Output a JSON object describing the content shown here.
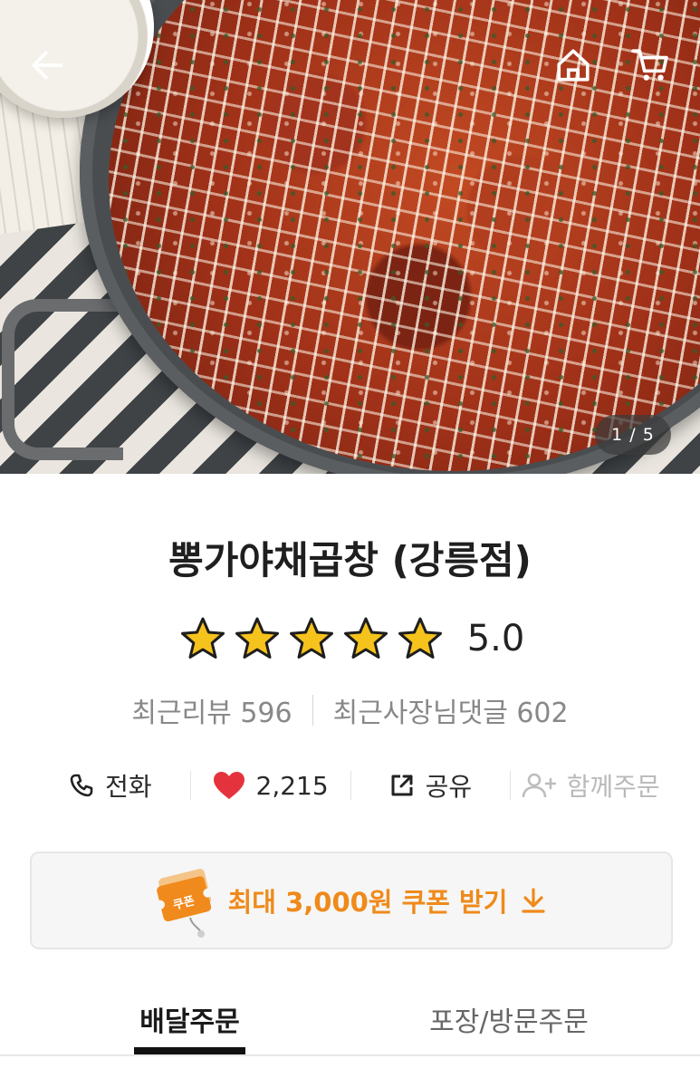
{
  "header": {
    "back_icon": "arrow-left-icon",
    "home_icon": "home-icon",
    "cart_icon": "cart-icon",
    "image_counter": "1 / 5"
  },
  "store": {
    "name": "뽕가야채곱창 (강릉점)",
    "rating": "5.0",
    "stars": 5,
    "recent_reviews": "최근리뷰 596",
    "owner_replies": "최근사장님댓글 602"
  },
  "actions": {
    "call_label": "전화",
    "like_count": "2,215",
    "share_label": "공유",
    "group_order_label": "함께주문"
  },
  "coupon": {
    "badge_text": "쿠폰",
    "label": "최대 3,000원 쿠폰 받기",
    "accent_color": "#ef8a1a"
  },
  "tabs": [
    {
      "label": "배달주문",
      "active": true
    },
    {
      "label": "포장/방문주문",
      "active": false
    }
  ],
  "colors": {
    "heart": "#e5333d",
    "star": "#f6c21c"
  }
}
